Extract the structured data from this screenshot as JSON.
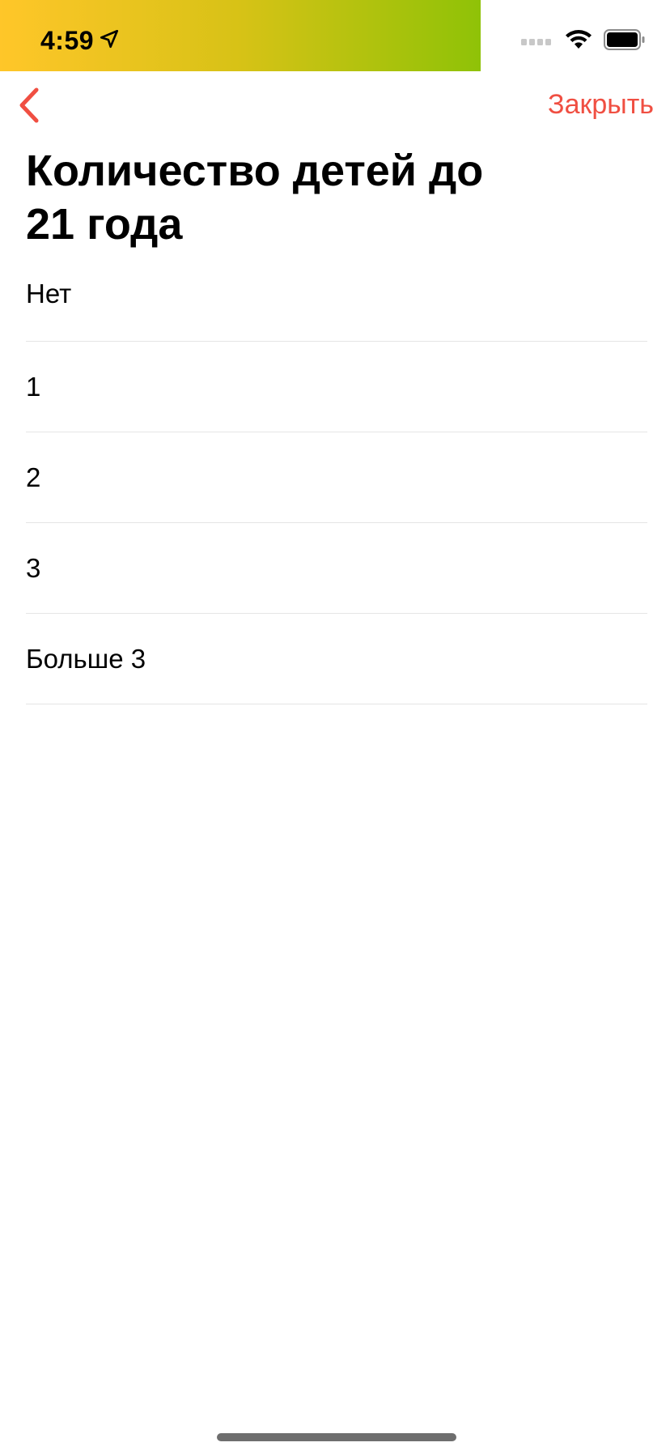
{
  "status_bar": {
    "time": "4:59",
    "gradient_colors": [
      "#ffc629",
      "#d7c216",
      "#8fc207"
    ]
  },
  "nav": {
    "close_label": "Закрыть",
    "accent_color": "#f04f42"
  },
  "page": {
    "title": "Количество детей до 21 года"
  },
  "options": [
    {
      "label": "Нет"
    },
    {
      "label": "1"
    },
    {
      "label": "2"
    },
    {
      "label": "3"
    },
    {
      "label": "Больше 3"
    }
  ],
  "icons": {
    "location": "location-arrow-icon",
    "signal": "cellular-signal-icon",
    "wifi": "wifi-icon",
    "battery": "battery-icon",
    "back": "chevron-left-icon"
  }
}
